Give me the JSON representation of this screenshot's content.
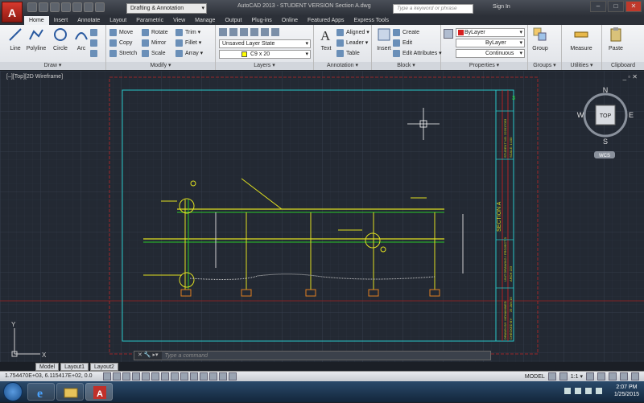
{
  "titlebar": {
    "app_logo": "A",
    "workspace": "Drafting & Annotation",
    "title": "AutoCAD 2013 - STUDENT VERSION   Section A.dwg",
    "search_placeholder": "Type a keyword or phrase",
    "sign_in": "Sign In",
    "win_min": "–",
    "win_max": "□",
    "win_close": "✕"
  },
  "tabs": [
    "Home",
    "Insert",
    "Annotate",
    "Layout",
    "Parametric",
    "View",
    "Manage",
    "Output",
    "Plug-ins",
    "Online",
    "Featured Apps",
    "Express Tools"
  ],
  "ribbon": {
    "draw": {
      "label": "Draw ▾",
      "line": "Line",
      "polyline": "Polyline",
      "circle": "Circle",
      "arc": "Arc"
    },
    "modify": {
      "label": "Modify ▾",
      "move": "Move",
      "rotate": "Rotate",
      "trim": "Trim ▾",
      "copy": "Copy",
      "mirror": "Mirror",
      "fillet": "Fillet ▾",
      "stretch": "Stretch",
      "scale": "Scale",
      "array": "Array ▾"
    },
    "layers": {
      "label": "Layers ▾",
      "layer_state": "Unsaved Layer State",
      "current_layer": "C9 x 20"
    },
    "annotation": {
      "label": "Annotation ▾",
      "text": "Text",
      "aligned": "Aligned ▾",
      "leader": "Leader ▾",
      "table": "Table"
    },
    "block": {
      "label": "Block ▾",
      "insert": "Insert",
      "create": "Create",
      "edit": "Edit",
      "edit_attributes": "Edit Attributes ▾"
    },
    "properties": {
      "label": "Properties ▾",
      "color": "ByLayer",
      "lineweight": "ByLayer",
      "linetype": "Continuous"
    },
    "groups": {
      "label": "Groups ▾",
      "group": "Group"
    },
    "utilities": {
      "label": "Utilities ▾",
      "measure": "Measure"
    },
    "clipboard": {
      "label": "Clipboard",
      "paste": "Paste"
    }
  },
  "viewport": {
    "label": "[–][Top][2D Wireframe]",
    "controls": "_ ▫ ✕",
    "viewcube": {
      "north": "N",
      "south": "S",
      "east": "E",
      "west": "W",
      "top": "TOP",
      "wcs": "WCS"
    },
    "ucs": {
      "x": "X",
      "y": "Y"
    },
    "title_block": {
      "section": "SECTION A",
      "sheet": "3",
      "student_no": "STUDENT NO. 222017053",
      "scale": "SCALE: 1:100",
      "project": "UNIT DRAWING / PROJECT 3",
      "course": "ARCH 223",
      "date": "25 JAN 15",
      "drawn_by": "DRAWN BY: MOHAMMED",
      "checked_by": "CHECKED BY:"
    }
  },
  "command_line": {
    "prefix": "✕ 🔧 ▸▾",
    "placeholder": "Type a command"
  },
  "layout_tabs": [
    "Model",
    "Layout1",
    "Layout2"
  ],
  "status": {
    "coords": "1.754470E+03, 6.115417E+02, 0.0",
    "model": "MODEL",
    "scale": "1:1 ▾"
  },
  "taskbar": {
    "time": "2:07 PM",
    "date": "1/25/2015"
  }
}
